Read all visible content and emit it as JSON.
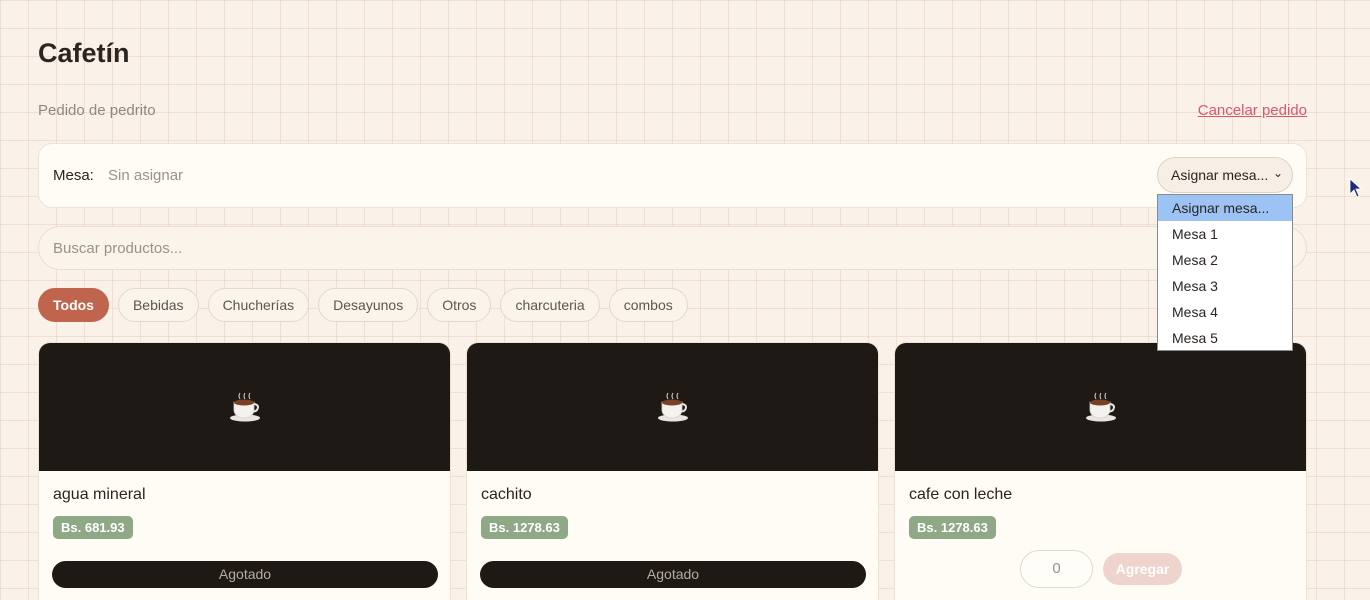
{
  "header": {
    "title": "Cafetín",
    "subtitle": "Pedido de pedrito",
    "cancel_label": "Cancelar pedido"
  },
  "mesa": {
    "label": "Mesa:",
    "value": "Sin asignar",
    "select_label": "Asignar mesa...",
    "options": [
      "Asignar mesa...",
      "Mesa 1",
      "Mesa 2",
      "Mesa 3",
      "Mesa 4",
      "Mesa 5"
    ],
    "selected_option": "Asignar mesa..."
  },
  "search": {
    "placeholder": "Buscar productos..."
  },
  "categories": [
    "Todos",
    "Bebidas",
    "Chucherías",
    "Desayunos",
    "Otros",
    "charcuteria",
    "combos"
  ],
  "active_category": "Todos",
  "products": [
    {
      "name": "agua mineral",
      "price": "Bs. 681.93",
      "status": "Agotado",
      "icon": "coffee-cup-icon"
    },
    {
      "name": "cachito",
      "price": "Bs. 1278.63",
      "status": "Agotado",
      "icon": "coffee-cup-icon"
    },
    {
      "name": "cafe con leche",
      "price": "Bs. 1278.63",
      "quantity": "0",
      "add_label": "Agregar",
      "icon": "coffee-cup-icon"
    }
  ],
  "colors": {
    "accent": "#c0644e",
    "price_badge": "#8fa886",
    "cancel_link": "#d9576b",
    "card_image_bg": "#1e1915"
  }
}
